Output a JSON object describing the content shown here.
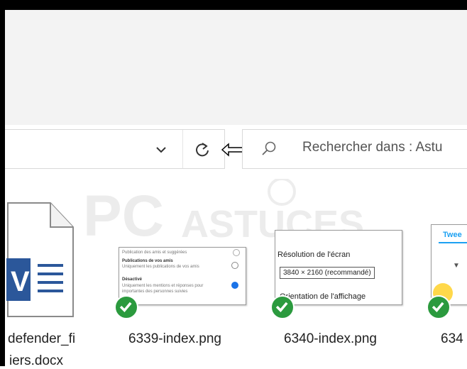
{
  "search": {
    "placeholder": "Rechercher dans : Astu"
  },
  "watermark": {
    "brand_left": "PC",
    "brand_right": "ASTUCES"
  },
  "files": [
    {
      "name_line1": "defender_fi",
      "name_line2": "iers.docx",
      "type": "word-document"
    },
    {
      "name": "6339-index.png",
      "synced": true
    },
    {
      "name": "6340-index.png",
      "synced": true
    },
    {
      "name": "634",
      "synced": true
    }
  ],
  "thumb_6339": {
    "line1": "Publication des amis et suggérées",
    "line2": "Publications de vos amis",
    "line3": "Uniquement les publications de vos amis",
    "line4": "Désactivé",
    "line5": "Uniquement les mentions et réponses pour",
    "line6": "importantes des personnes suivies"
  },
  "thumb_6340": {
    "label1": "Résolution de l'écran",
    "value": "3840 × 2160 (recommandé)",
    "label2": "Orientation de l'affichage"
  },
  "thumb_634x": {
    "title": "Twee"
  },
  "colors": {
    "word_blue": "#2b579a",
    "check_green": "#2b9a3e",
    "twitter_blue": "#1da1f2"
  }
}
